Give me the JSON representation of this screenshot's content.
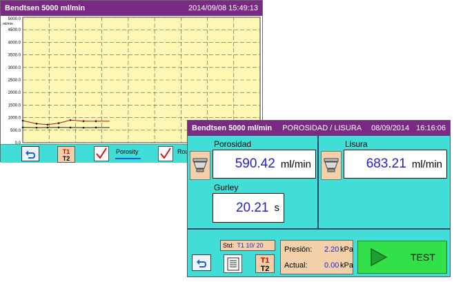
{
  "back_window": {
    "title": "Bendtsen   5000 ml/min",
    "datetime": "2014/09/08    15:49:13",
    "legend": [
      {
        "label": "Porosity",
        "checked": true
      },
      {
        "label": "Rou",
        "checked": true
      }
    ],
    "t1_label": "T1",
    "t2_label": "T2"
  },
  "chart_data": {
    "type": "line",
    "y_unit": "ml/min",
    "y_ticks": [
      "5000.0",
      "4500.0",
      "4000.0",
      "3500.0",
      "3000.0",
      "2500.0",
      "2000.0",
      "1500.0",
      "1000.0",
      "500.0",
      "0.0"
    ],
    "ylim": [
      0,
      5000
    ],
    "grid": true,
    "series": [
      {
        "name": "Porosity",
        "color": "#222222",
        "values": [
          610,
          600,
          605,
          610,
          605,
          600,
          605
        ]
      },
      {
        "name": "Rou",
        "color": "#aa1111",
        "values": [
          880,
          760,
          720,
          780,
          900,
          860,
          860
        ]
      }
    ]
  },
  "front_window": {
    "title_left": "Bendtsen   5000 ml/min",
    "mode": "POROSIDAD / LISURA",
    "date": "08/09/2014",
    "time": "16:16:06",
    "porosidad": {
      "label": "Porosidad",
      "value": "590.42",
      "unit": "ml/min"
    },
    "lisura": {
      "label": "Lisura",
      "value": "683.21",
      "unit": "ml/min"
    },
    "gurley": {
      "label": "Gurley",
      "value": "20.21",
      "unit": "s"
    },
    "std": {
      "label": "Std:",
      "value": "T1  10/ 20"
    },
    "presion": {
      "label": "Presión:",
      "value": "2.20",
      "unit": "kPa"
    },
    "actual": {
      "label": "Actual:",
      "value": "0.00",
      "unit": "kPa"
    },
    "test_label": "TEST",
    "t1_label": "T1",
    "t2_label": "T2"
  },
  "colors": {
    "titlebar": "#7a2a85",
    "panel": "#40ded6",
    "plot_bg": "#fff8b4",
    "test_button": "#33e04a",
    "accent_value": "#2222cc"
  }
}
